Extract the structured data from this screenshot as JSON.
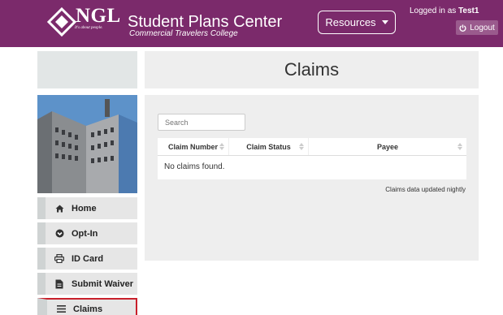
{
  "header": {
    "logo_text": "NGL",
    "logo_tagline": "It's about people.",
    "title": "Student Plans Center",
    "subtitle": "Commercial Travelers College",
    "resources_label": "Resources",
    "logged_in_prefix": "Logged in as",
    "username": "Test1",
    "logout_label": "Logout",
    "brand_color": "#7b2a6b"
  },
  "main": {
    "page_title": "Claims",
    "search_placeholder": "Search",
    "columns": [
      "Claim Number",
      "Claim Status",
      "Payee"
    ],
    "empty_message": "No claims found.",
    "updated_note": "Claims data updated nightly"
  },
  "sidebar": {
    "items": [
      {
        "label": "Home",
        "icon": "home-icon"
      },
      {
        "label": "Opt-In",
        "icon": "opt-in-icon"
      },
      {
        "label": "ID Card",
        "icon": "print-icon"
      },
      {
        "label": "Submit Waiver",
        "icon": "document-icon"
      },
      {
        "label": "Claims",
        "icon": "list-icon",
        "active": true
      }
    ]
  }
}
